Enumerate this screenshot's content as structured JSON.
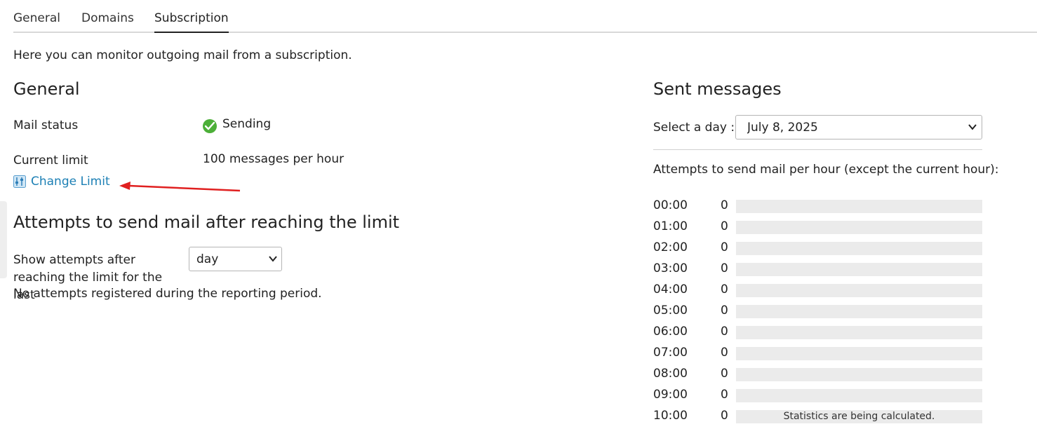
{
  "tabs": [
    {
      "label": "General",
      "active": false
    },
    {
      "label": "Domains",
      "active": false
    },
    {
      "label": "Subscription",
      "active": true
    }
  ],
  "intro": "Here you can monitor outgoing mail from a subscription.",
  "general": {
    "heading": "General",
    "mail_status_label": "Mail status",
    "mail_status_value": "Sending",
    "mail_status_icon": "check-circle-icon",
    "current_limit_label": "Current limit",
    "current_limit_value": "100 messages per hour",
    "change_limit_label": "Change Limit",
    "change_limit_icon": "limit-icon"
  },
  "attempts": {
    "heading": "Attempts to send mail after reaching the limit",
    "period_label": "Show attempts after reaching the limit for the last",
    "period_selected": "day",
    "empty_message": "No attempts registered during the reporting period."
  },
  "sent": {
    "heading": "Sent messages",
    "select_day_label": "Select a day :",
    "selected_day": "July 8, 2025",
    "per_hour_caption": "Attempts to send mail per hour (except the current hour):",
    "hours": [
      {
        "hour": "00:00",
        "count": "0",
        "note": ""
      },
      {
        "hour": "01:00",
        "count": "0",
        "note": ""
      },
      {
        "hour": "02:00",
        "count": "0",
        "note": ""
      },
      {
        "hour": "03:00",
        "count": "0",
        "note": ""
      },
      {
        "hour": "04:00",
        "count": "0",
        "note": ""
      },
      {
        "hour": "05:00",
        "count": "0",
        "note": ""
      },
      {
        "hour": "06:00",
        "count": "0",
        "note": ""
      },
      {
        "hour": "07:00",
        "count": "0",
        "note": ""
      },
      {
        "hour": "08:00",
        "count": "0",
        "note": ""
      },
      {
        "hour": "09:00",
        "count": "0",
        "note": ""
      },
      {
        "hour": "10:00",
        "count": "0",
        "note": "Statistics are being calculated."
      }
    ]
  },
  "colors": {
    "link": "#1d80b5",
    "success": "#4caf38",
    "bar_bg": "#ebebeb",
    "annotation_arrow": "#e02020"
  }
}
